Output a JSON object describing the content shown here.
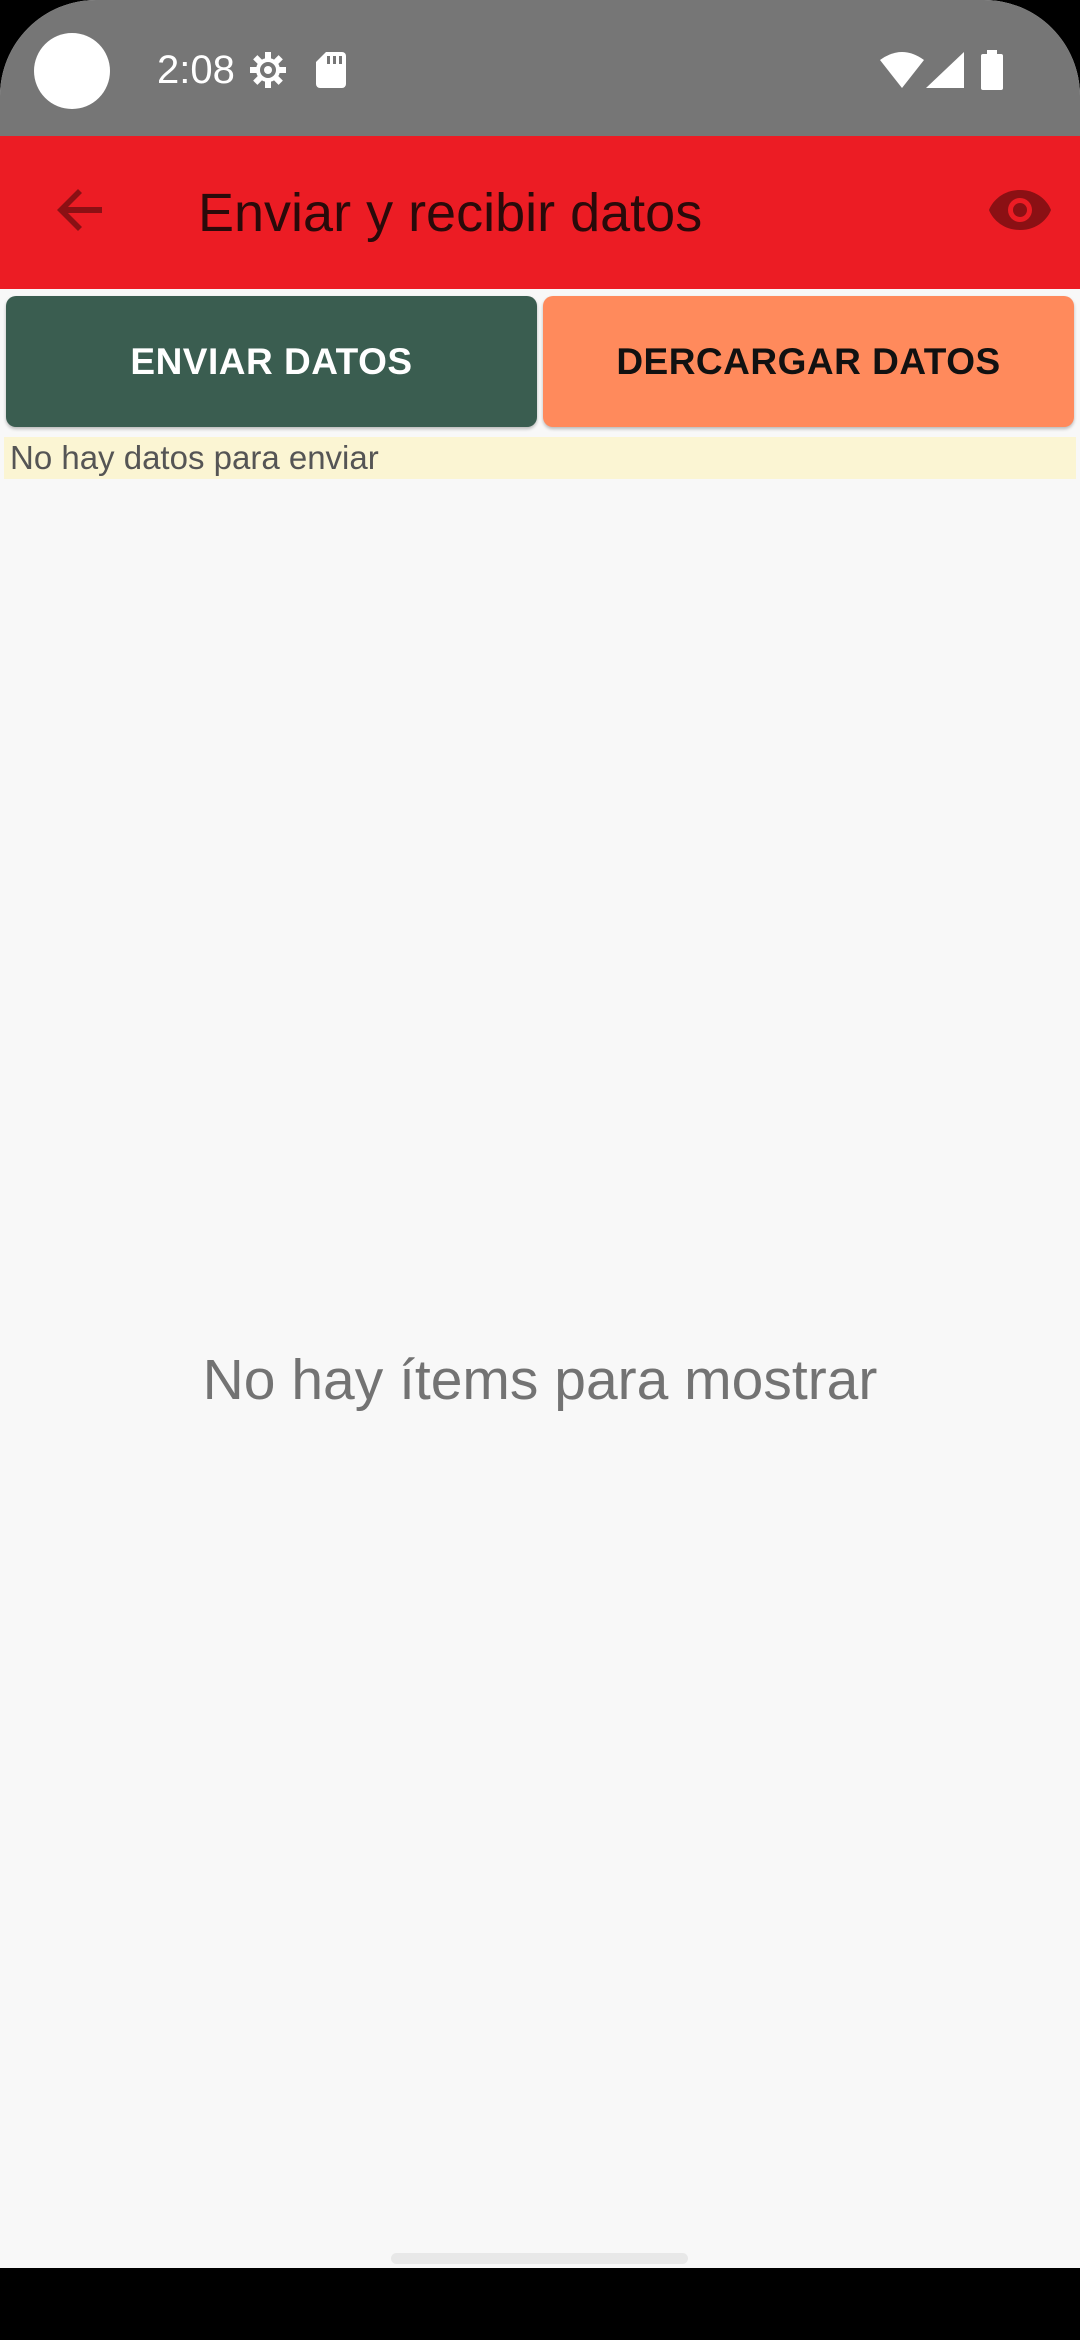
{
  "status_bar": {
    "time": "2:08",
    "icons": [
      "settings-gear-icon",
      "sd-card-icon",
      "wifi-icon",
      "cellular-signal-icon",
      "battery-icon"
    ]
  },
  "app_bar": {
    "title": "Enviar y recibir datos",
    "back_icon": "arrow-back-icon",
    "action_icon": "eye-icon",
    "color": "#ec1c24"
  },
  "actions": {
    "send_label": "ENVIAR DATOS",
    "download_label": "DERCARGAR DATOS",
    "send_color": "#3a5d50",
    "download_color": "#ff8a5c"
  },
  "notice": {
    "text": "No hay datos para enviar",
    "color": "#fbf5d3"
  },
  "list": {
    "empty_text": "No hay ítems para mostrar"
  }
}
